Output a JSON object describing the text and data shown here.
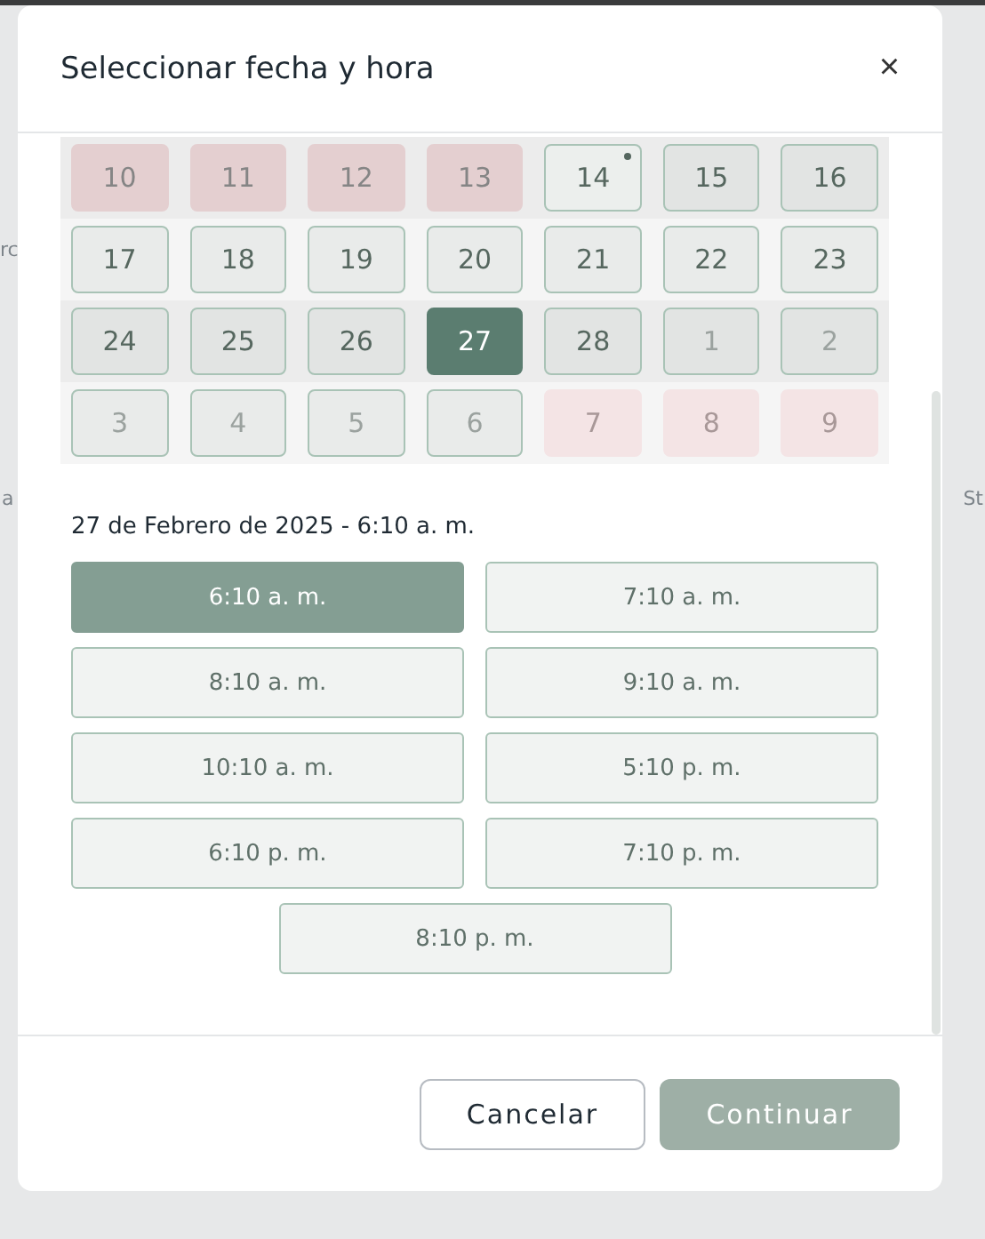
{
  "background": {
    "fragments": [
      {
        "text": "rc"
      },
      {
        "text": "a"
      },
      {
        "text": "St"
      }
    ]
  },
  "dialog": {
    "title": "Seleccionar fecha y hora",
    "close": "×"
  },
  "calendar": {
    "weeks": [
      {
        "days": [
          {
            "label": "10",
            "kind": "blocked",
            "other_month": false,
            "selected": false,
            "today": false
          },
          {
            "label": "11",
            "kind": "blocked",
            "other_month": false,
            "selected": false,
            "today": false
          },
          {
            "label": "12",
            "kind": "blocked",
            "other_month": false,
            "selected": false,
            "today": false
          },
          {
            "label": "13",
            "kind": "blocked",
            "other_month": false,
            "selected": false,
            "today": false
          },
          {
            "label": "14",
            "kind": "available",
            "other_month": false,
            "selected": false,
            "today": true
          },
          {
            "label": "15",
            "kind": "available",
            "other_month": false,
            "selected": false,
            "today": false
          },
          {
            "label": "16",
            "kind": "available",
            "other_month": false,
            "selected": false,
            "today": false
          }
        ]
      },
      {
        "days": [
          {
            "label": "17",
            "kind": "available",
            "other_month": false,
            "selected": false,
            "today": false
          },
          {
            "label": "18",
            "kind": "available",
            "other_month": false,
            "selected": false,
            "today": false
          },
          {
            "label": "19",
            "kind": "available",
            "other_month": false,
            "selected": false,
            "today": false
          },
          {
            "label": "20",
            "kind": "available",
            "other_month": false,
            "selected": false,
            "today": false
          },
          {
            "label": "21",
            "kind": "available",
            "other_month": false,
            "selected": false,
            "today": false
          },
          {
            "label": "22",
            "kind": "available",
            "other_month": false,
            "selected": false,
            "today": false
          },
          {
            "label": "23",
            "kind": "available",
            "other_month": false,
            "selected": false,
            "today": false
          }
        ]
      },
      {
        "days": [
          {
            "label": "24",
            "kind": "available",
            "other_month": false,
            "selected": false,
            "today": false
          },
          {
            "label": "25",
            "kind": "available",
            "other_month": false,
            "selected": false,
            "today": false
          },
          {
            "label": "26",
            "kind": "available",
            "other_month": false,
            "selected": false,
            "today": false
          },
          {
            "label": "27",
            "kind": "available",
            "other_month": false,
            "selected": true,
            "today": false
          },
          {
            "label": "28",
            "kind": "available",
            "other_month": false,
            "selected": false,
            "today": false
          },
          {
            "label": "1",
            "kind": "available",
            "other_month": true,
            "selected": false,
            "today": false
          },
          {
            "label": "2",
            "kind": "available",
            "other_month": true,
            "selected": false,
            "today": false
          }
        ]
      },
      {
        "days": [
          {
            "label": "3",
            "kind": "available",
            "other_month": true,
            "selected": false,
            "today": false
          },
          {
            "label": "4",
            "kind": "available",
            "other_month": true,
            "selected": false,
            "today": false
          },
          {
            "label": "5",
            "kind": "available",
            "other_month": true,
            "selected": false,
            "today": false
          },
          {
            "label": "6",
            "kind": "available",
            "other_month": true,
            "selected": false,
            "today": false
          },
          {
            "label": "7",
            "kind": "blocked",
            "other_month": true,
            "selected": false,
            "today": false
          },
          {
            "label": "8",
            "kind": "blocked",
            "other_month": true,
            "selected": false,
            "today": false
          },
          {
            "label": "9",
            "kind": "blocked",
            "other_month": true,
            "selected": false,
            "today": false
          }
        ]
      }
    ]
  },
  "summary": "27 de Febrero de 2025 - 6:10 a. m.",
  "times": [
    {
      "label": "6:10 a. m.",
      "selected": true
    },
    {
      "label": "7:10 a. m.",
      "selected": false
    },
    {
      "label": "8:10 a. m.",
      "selected": false
    },
    {
      "label": "9:10 a. m.",
      "selected": false
    },
    {
      "label": "10:10 a. m.",
      "selected": false
    },
    {
      "label": "5:10 p. m.",
      "selected": false
    },
    {
      "label": "6:10 p. m.",
      "selected": false
    },
    {
      "label": "7:10 p. m.",
      "selected": false
    },
    {
      "label": "8:10 p. m.",
      "selected": false
    }
  ],
  "buttons": [
    {
      "label": "Cancelar",
      "kind": "secondary",
      "disabled": false
    },
    {
      "label": "Continuar",
      "kind": "primary",
      "disabled": true
    }
  ]
}
